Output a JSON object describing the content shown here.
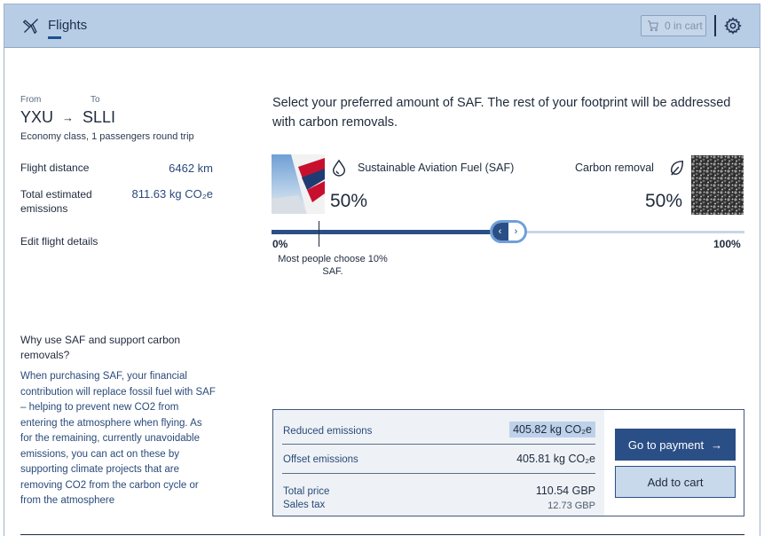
{
  "header": {
    "tab_label": "Flights",
    "cart_label": "0 in cart",
    "icons": {
      "tab": "plane-icon",
      "cart": "cart-icon",
      "settings": "gear-icon"
    }
  },
  "flight": {
    "from_label": "From",
    "to_label": "To",
    "from_code": "YXU",
    "to_code": "SLLI",
    "class_line": "Economy class, 1 passengers round trip",
    "distance_label": "Flight distance",
    "distance_value": "6462 km",
    "emissions_label": "Total estimated emissions",
    "emissions_value": "811.63 kg CO₂e",
    "edit_link": "Edit flight details"
  },
  "info": {
    "why_title": "Why use SAF and support carbon removals?",
    "why_body": "When purchasing SAF, your financial contribution will replace fossil fuel with SAF – helping to prevent new CO2 from entering the atmosphere when flying. As for the remaining, currently unavoidable emissions, you can act on these by supporting climate projects that are removing CO2 from the carbon cycle or from the atmosphere"
  },
  "selector": {
    "prompt": "Select your preferred amount of SAF. The rest of your footprint will be addressed with carbon removals.",
    "saf_title": "Sustainable Aviation Fuel (SAF)",
    "saf_percent": "50%",
    "carbon_title": "Carbon removal",
    "carbon_percent": "50%",
    "slider_min_label": "0%",
    "slider_max_label": "100%",
    "slider_value": 0.5,
    "marker_value": 0.1,
    "marker_note": "Most people choose 10% SAF.",
    "thumb_left": "‹",
    "thumb_right": "›"
  },
  "summary": {
    "reduced_label": "Reduced emissions",
    "reduced_value": "405.82 kg CO₂e",
    "offset_label": "Offset emissions",
    "offset_value": "405.81 kg CO₂e",
    "total_label": "Total price",
    "total_value": "110.54 GBP",
    "tax_label": "Sales tax",
    "tax_value": "12.73 GBP",
    "pay_label": "Go to payment",
    "add_label": "Add to cart"
  },
  "colors": {
    "header_bg": "#b7cde6",
    "primary": "#2a4f86",
    "accent_light": "#c9d9ec"
  }
}
